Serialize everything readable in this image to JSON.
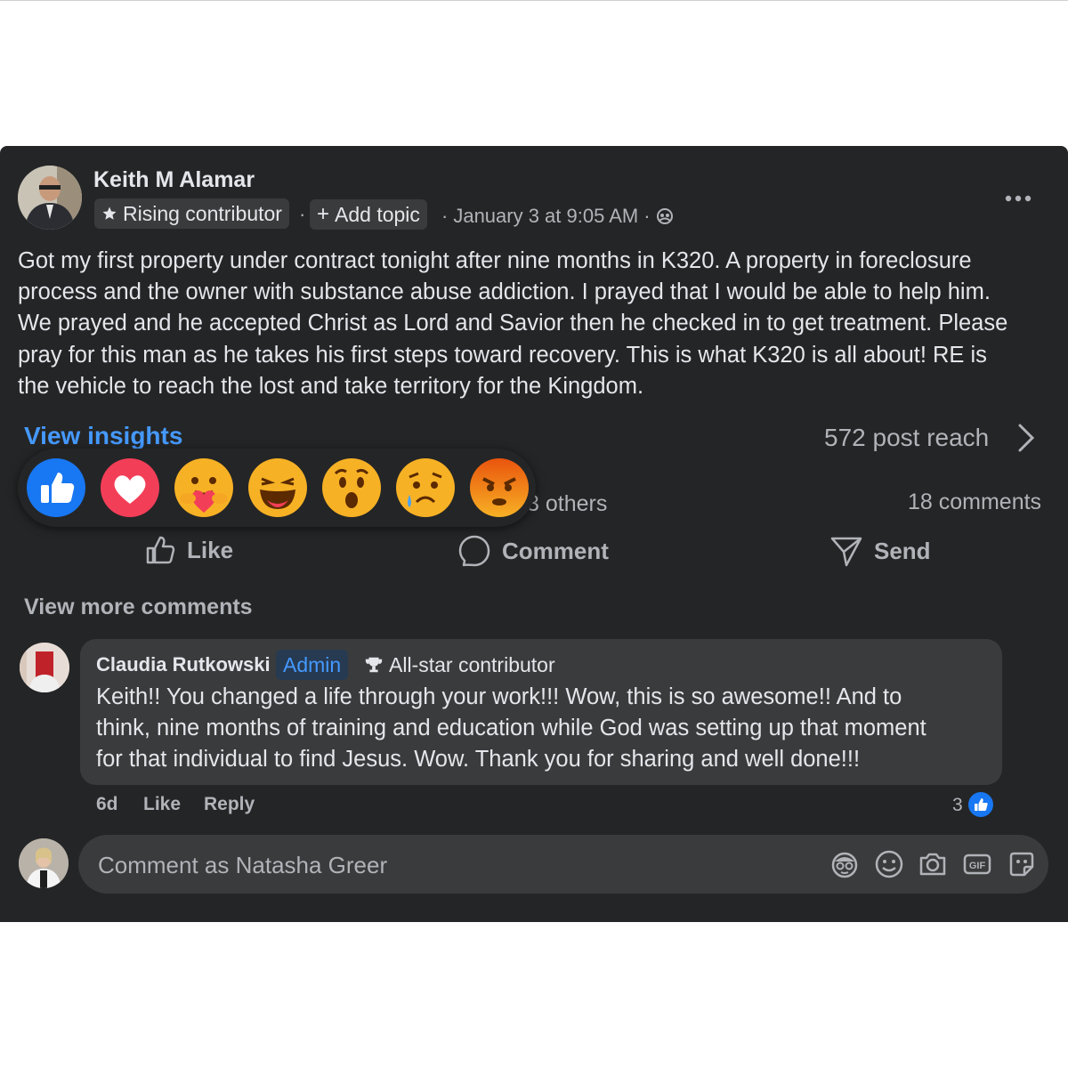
{
  "post": {
    "author": "Keith M Alamar",
    "badge": "Rising contributor",
    "add_topic": "Add topic",
    "timestamp": "January 3 at 9:05 AM",
    "more_icon": "more-dots-icon",
    "text_lines": [
      "Got my first property under contract tonight after nine months in K320. A property in foreclosure",
      "process and the owner with substance abuse addiction. I prayed that I would be able to help him.",
      "We prayed and he accepted Christ as Lord and Savior then he checked in to get treatment.  Please",
      "pray for this man as he takes his first steps toward recovery.  This is what K320 is all about!  RE is",
      "the vehicle to reach the lost and take territory for the Kingdom."
    ]
  },
  "insights": {
    "view_label": "View insights",
    "reach": "572 post reach"
  },
  "reactions": {
    "others_text": "3 others",
    "comments_count": "18 comments",
    "types": [
      "like",
      "love",
      "care",
      "haha",
      "wow",
      "sad",
      "angry"
    ]
  },
  "actions": {
    "like": "Like",
    "comment": "Comment",
    "send": "Send"
  },
  "comments": {
    "view_more": "View more comments",
    "items": [
      {
        "author": "Claudia Rutkowski",
        "role": "Admin",
        "badge": "All-star contributor",
        "text_lines": [
          "Keith!! You changed a life through your work!!! Wow, this is so awesome!! And to",
          "think, nine months of training and education while God was setting up that moment",
          "for that individual to find Jesus. Wow. Thank you for sharing and well done!!!"
        ],
        "age": "6d",
        "like": "Like",
        "reply": "Reply",
        "reaction_count": "3"
      }
    ]
  },
  "composer": {
    "placeholder": "Comment as Natasha Greer",
    "tools": [
      "avatar-sticker-icon",
      "emoji-icon",
      "camera-icon",
      "gif-icon",
      "sticker-icon"
    ]
  },
  "colors": {
    "card_bg": "#242526",
    "bubble_bg": "#3a3b3c",
    "link_blue": "#4599ff",
    "text": "#e4e6eb",
    "muted": "#b0b3b8"
  }
}
